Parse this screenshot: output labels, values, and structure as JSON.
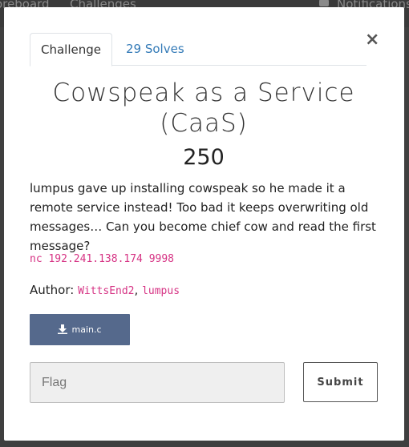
{
  "backdrop": {
    "nav_scoreboard": "oreboard",
    "nav_challenges": "Challenges",
    "nav_notifications": "Notifications"
  },
  "modal": {
    "tabs": {
      "challenge": "Challenge",
      "solves": "29 Solves"
    },
    "close_label": "×",
    "title": "Cowspeak as a Service (CaaS)",
    "points": "250",
    "description": "lumpus gave up installing cowspeak so he made it a remote service instead! Too bad it keeps overwriting old messages… Can you become chief cow and read the first message?",
    "connect": "nc 192.241.138.174 9998",
    "author": {
      "prefix": "Author: ",
      "name1": "WittsEnd2",
      "separator": ", ",
      "name2": "lumpus"
    },
    "file": {
      "label": "main.c",
      "icon": "download-icon"
    },
    "flag_input": {
      "placeholder": "Flag",
      "value": ""
    },
    "submit_label": "Submit"
  },
  "colors": {
    "link": "#337ab7",
    "code": "#d63384",
    "file_button": "#55698c"
  }
}
